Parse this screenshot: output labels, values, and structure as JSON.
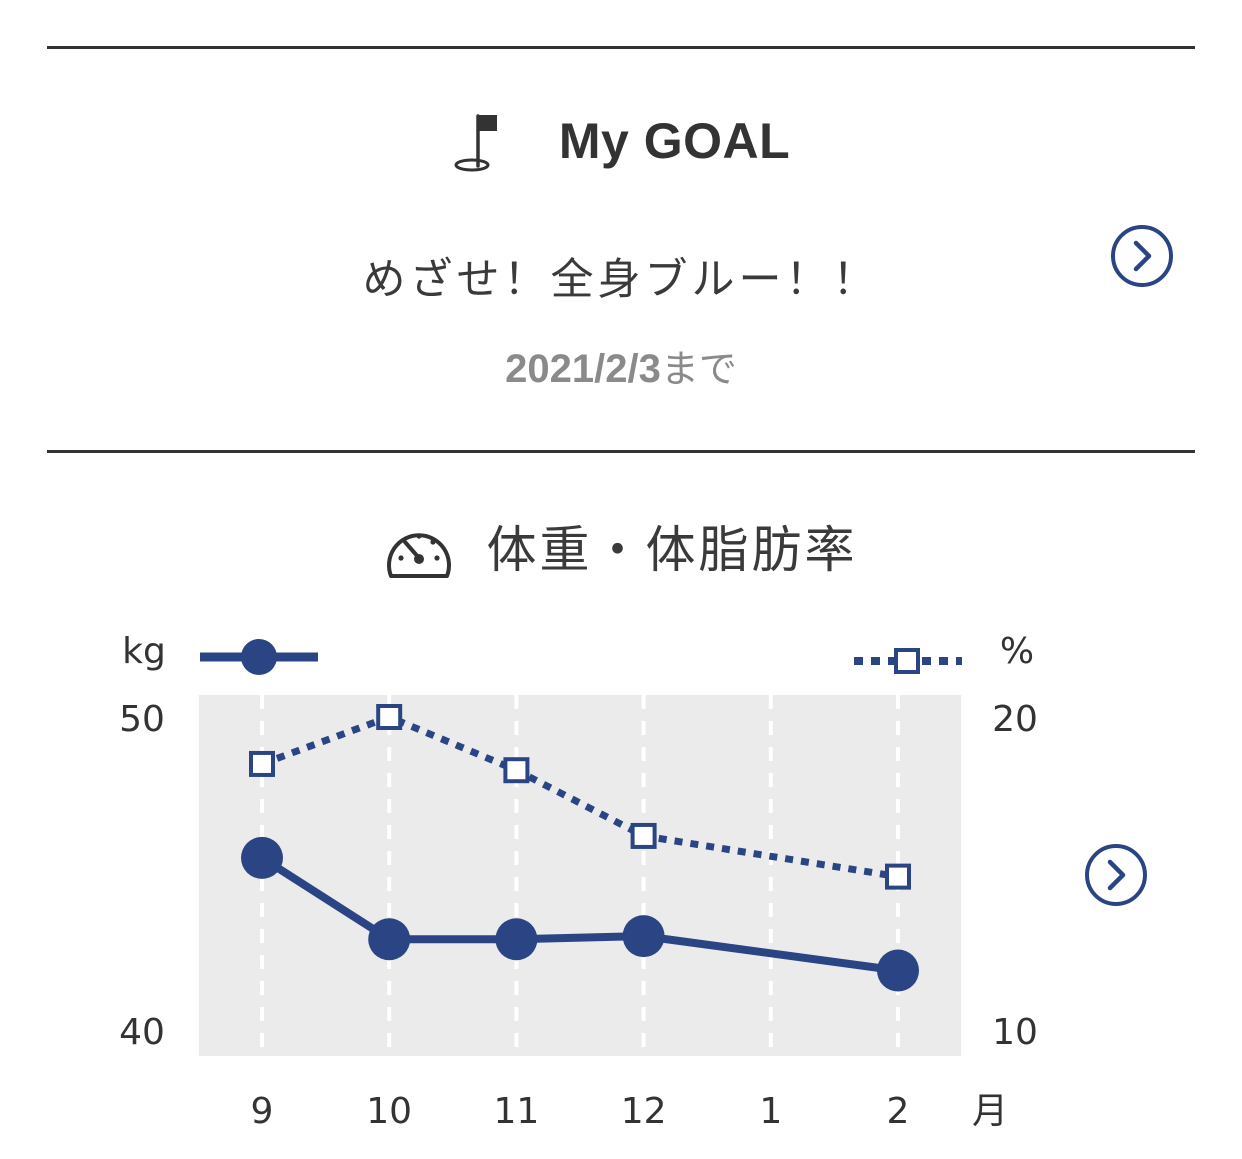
{
  "goal": {
    "title": "My GOAL",
    "text": "めざせ！全身ブルー！！",
    "deadline_date": "2021/2/3",
    "deadline_suffix": "まで",
    "icon": "flag-icon"
  },
  "weight_section": {
    "title": "体重・体脂肪率",
    "icon": "gauge-icon"
  },
  "buttons": {
    "goal_detail_icon": "chevron-right-circle-icon",
    "chart_detail_icon": "chevron-right-circle-icon"
  },
  "colors": {
    "accent": "#2b4584",
    "plot_background": "#ebebeb",
    "text": "#333333",
    "subtext": "#8a8a8a"
  },
  "chart_data": {
    "type": "line",
    "left_unit": "kg",
    "right_unit": "%",
    "x_unit": "月",
    "categories": [
      "9",
      "10",
      "11",
      "12",
      "1",
      "2"
    ],
    "y_left": {
      "min": 40,
      "max": 50,
      "ticks": [
        50,
        40
      ]
    },
    "y_right": {
      "min": 10,
      "max": 20,
      "ticks": [
        20,
        10
      ]
    },
    "grid": "vertical dashed",
    "series": [
      {
        "axis": "left",
        "style": "solid, filled circles",
        "values": [
          45.5,
          42.9,
          42.9,
          43.0,
          null,
          41.9
        ]
      },
      {
        "axis": "right",
        "style": "dotted, hollow squares",
        "values": [
          18.5,
          20.0,
          18.3,
          16.2,
          null,
          14.9
        ]
      }
    ]
  }
}
